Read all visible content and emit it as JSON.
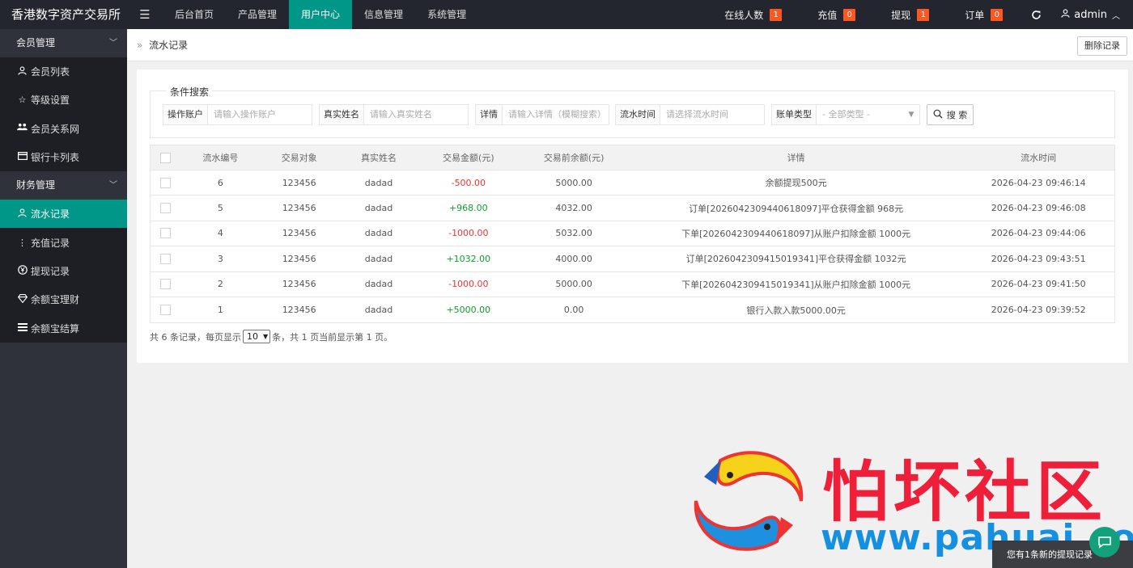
{
  "app": {
    "title": "香港数字资产交易所",
    "menu_icon": "menu-icon"
  },
  "topnav": [
    {
      "label": "后台首页",
      "active": false
    },
    {
      "label": "产品管理",
      "active": false
    },
    {
      "label": "用户中心",
      "active": true
    },
    {
      "label": "信息管理",
      "active": false
    },
    {
      "label": "系统管理",
      "active": false
    }
  ],
  "stats": [
    {
      "label": "在线人数",
      "count": "1"
    },
    {
      "label": "充值",
      "count": "0"
    },
    {
      "label": "提现",
      "count": "1"
    },
    {
      "label": "订单",
      "count": "0"
    }
  ],
  "user": {
    "name": "admin"
  },
  "sidebar": {
    "groups": [
      {
        "label": "会员管理",
        "items": [
          {
            "label": "会员列表",
            "icon": "user-icon"
          },
          {
            "label": "等级设置",
            "icon": "star-icon"
          },
          {
            "label": "会员关系网",
            "icon": "users-icon"
          },
          {
            "label": "银行卡列表",
            "icon": "credit-card-icon"
          }
        ]
      },
      {
        "label": "财务管理",
        "items": [
          {
            "label": "流水记录",
            "icon": "user-icon",
            "active": true
          },
          {
            "label": "充值记录",
            "icon": "dots-vertical-icon"
          },
          {
            "label": "提现记录",
            "icon": "yen-circle-icon"
          },
          {
            "label": "余额宝理财",
            "icon": "diamond-icon"
          },
          {
            "label": "余额宝结算",
            "icon": "list-icon"
          }
        ]
      }
    ]
  },
  "header": {
    "breadcrumb": "流水记录",
    "delete_button": "删除记录"
  },
  "search": {
    "legend": "条件搜索",
    "fields": [
      {
        "label": "操作账户",
        "placeholder": "请输入操作账户"
      },
      {
        "label": "真实姓名",
        "placeholder": "请输入真实姓名"
      },
      {
        "label": "详情",
        "placeholder": "请输入详情（模糊搜索）"
      },
      {
        "label": "流水时间",
        "placeholder": "请选择流水时间"
      },
      {
        "label": "账单类型",
        "placeholder": "- 全部类型 -"
      }
    ],
    "button": "搜 索"
  },
  "table": {
    "columns": [
      "流水编号",
      "交易对象",
      "真实姓名",
      "交易金额(元)",
      "交易前余额(元)",
      "详情",
      "流水时间"
    ],
    "rows": [
      {
        "id": "6",
        "target": "123456",
        "name": "dadad",
        "amount": "-500.00",
        "sign": "neg",
        "before": "5000.00",
        "detail": "余额提现500元",
        "time": "2026-04-23 09:46:14"
      },
      {
        "id": "5",
        "target": "123456",
        "name": "dadad",
        "amount": "+968.00",
        "sign": "pos",
        "before": "4032.00",
        "detail": "订单[2026042309440618097]平仓获得金额 968元",
        "time": "2026-04-23 09:46:08"
      },
      {
        "id": "4",
        "target": "123456",
        "name": "dadad",
        "amount": "-1000.00",
        "sign": "neg",
        "before": "5032.00",
        "detail": "下单[2026042309440618097]从账户扣除金额 1000元",
        "time": "2026-04-23 09:44:06"
      },
      {
        "id": "3",
        "target": "123456",
        "name": "dadad",
        "amount": "+1032.00",
        "sign": "pos",
        "before": "4000.00",
        "detail": "订单[2026042309415019341]平仓获得金额 1032元",
        "time": "2026-04-23 09:43:51"
      },
      {
        "id": "2",
        "target": "123456",
        "name": "dadad",
        "amount": "-1000.00",
        "sign": "neg",
        "before": "5000.00",
        "detail": "下单[2026042309415019341]从账户扣除金额 1000元",
        "time": "2026-04-23 09:41:50"
      },
      {
        "id": "1",
        "target": "123456",
        "name": "dadad",
        "amount": "+5000.00",
        "sign": "pos",
        "before": "0.00",
        "detail": "银行入款入款5000.00元",
        "time": "2026-04-23 09:39:52"
      }
    ]
  },
  "pager": {
    "prefix": "共 6 条记录，每页显示",
    "page_size": "10",
    "suffix": "条，共 1 页当前显示第 1 页。"
  },
  "watermark": {
    "text": "怕坏社区",
    "url": "www.pahuai.com"
  },
  "toast": "您有1条新的提现记录",
  "colors": {
    "accent": "#009688",
    "topbar": "#23262e",
    "sidebar": "#2f323a",
    "badge": "#ff5722",
    "negative": "#ee3333",
    "positive": "#119d2b"
  }
}
